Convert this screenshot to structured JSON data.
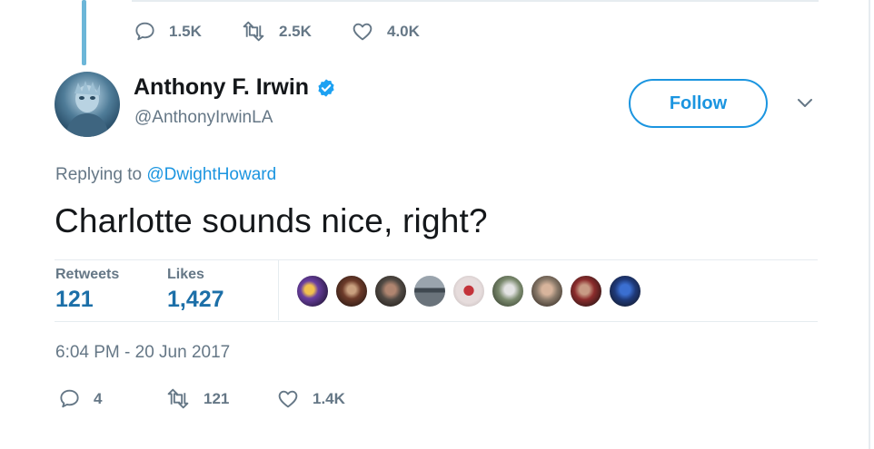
{
  "previous_tweet": {
    "actions": [
      {
        "name": "reply",
        "icon": "reply-icon",
        "count": "1.5K"
      },
      {
        "name": "retweet",
        "icon": "retweet-icon",
        "count": "2.5K"
      },
      {
        "name": "like",
        "icon": "heart-icon",
        "count": "4.0K"
      }
    ]
  },
  "tweet": {
    "author": {
      "name": "Anthony F. Irwin",
      "handle": "@AnthonyIrwinLA",
      "verified": true
    },
    "follow_label": "Follow",
    "replying_prefix": "Replying to",
    "replying_to": "@DwightHoward",
    "text": "Charlotte sounds nice, right?",
    "stats": {
      "retweets_label": "Retweets",
      "retweets_value": "121",
      "likes_label": "Likes",
      "likes_value": "1,427"
    },
    "liked_by_count_shown": 9,
    "timestamp": "6:04 PM - 20 Jun 2017",
    "actions": [
      {
        "name": "reply",
        "icon": "reply-icon",
        "count": "4"
      },
      {
        "name": "retweet",
        "icon": "retweet-icon",
        "count": "121"
      },
      {
        "name": "like",
        "icon": "heart-icon",
        "count": "1.4K"
      }
    ]
  },
  "colors": {
    "accent": "#1b95e0",
    "muted_text": "#657786",
    "thread_line": "#6cb6d8",
    "divider": "#e6ecf0"
  }
}
